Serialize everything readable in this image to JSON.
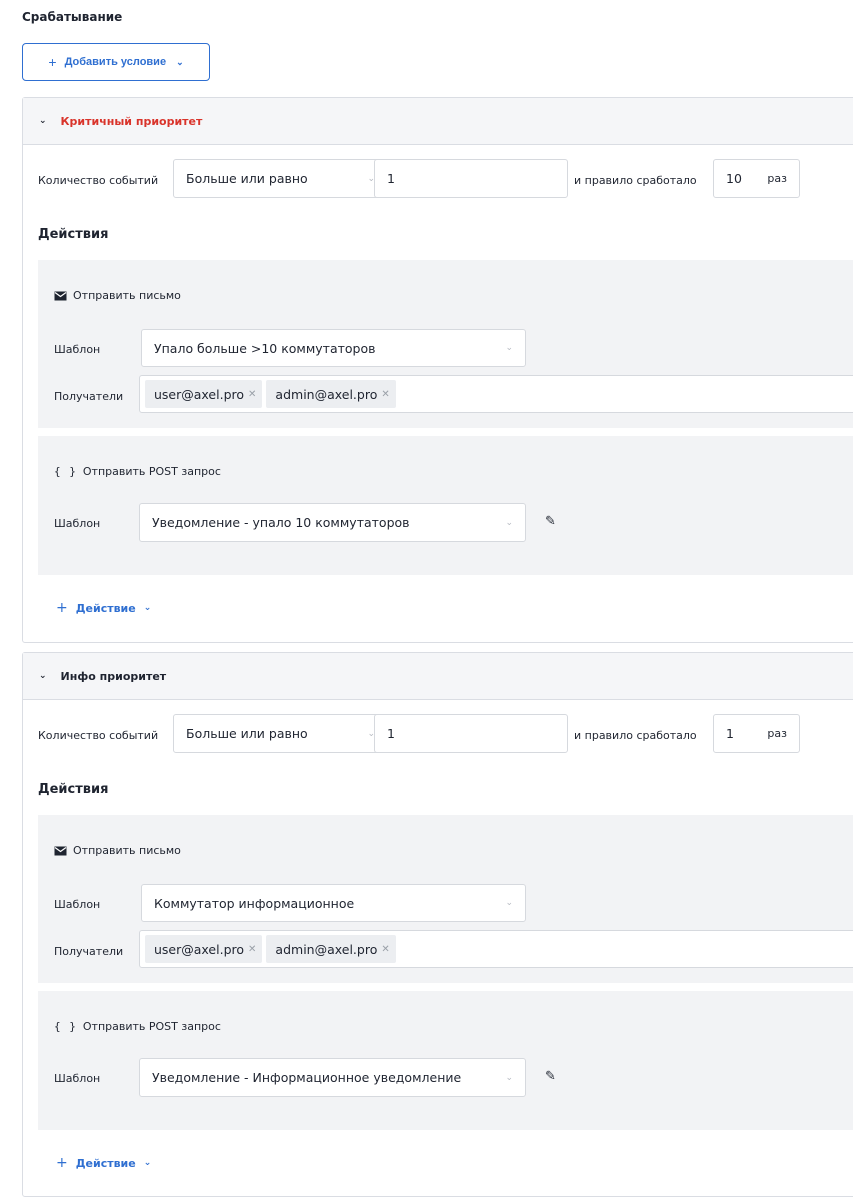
{
  "section_title": "Срабатывание",
  "add_condition_label": "Добавить условие",
  "panels": [
    {
      "title": "Критичный приоритет",
      "events_label": "Количество событий",
      "operator": "Больше или равно",
      "events_value": "1",
      "triggered_label": "и правило сработало",
      "times_value": "10",
      "times_unit": "раз",
      "actions_heading": "Действия",
      "email_title": "Отправить письмо",
      "email_template_label": "Шаблон",
      "email_template": "Упало больше >10 коммутаторов",
      "recipients_label": "Получатели",
      "recipients": [
        "user@axel.pro",
        "admin@axel.pro"
      ],
      "post_title": "Отправить POST запрос",
      "post_template_label": "Шаблон",
      "post_template": "Уведомление - упало 10 коммутаторов",
      "add_action_label": "Действие"
    },
    {
      "title": "Инфо приоритет",
      "events_label": "Количество событий",
      "operator": "Больше или равно",
      "events_value": "1",
      "triggered_label": "и правило сработало",
      "times_value": "1",
      "times_unit": "раз",
      "actions_heading": "Действия",
      "email_title": "Отправить письмо",
      "email_template_label": "Шаблон",
      "email_template": "Коммутатор информационное",
      "recipients_label": "Получатели",
      "recipients": [
        "user@axel.pro",
        "admin@axel.pro"
      ],
      "post_title": "Отправить POST запрос",
      "post_template_label": "Шаблон",
      "post_template": "Уведомление - Информационное уведомление",
      "add_action_label": "Действие"
    }
  ],
  "colors": {
    "accent": "#2f6fd1",
    "critical": "#d9342b",
    "action_bg": "#f2f3f5",
    "header_bg": "#f5f6f8"
  },
  "icons": {
    "chevron": "chevron-down-icon",
    "mail": "mail-icon",
    "braces": "braces-icon",
    "edit": "pencil-icon",
    "remove": "close-icon"
  }
}
